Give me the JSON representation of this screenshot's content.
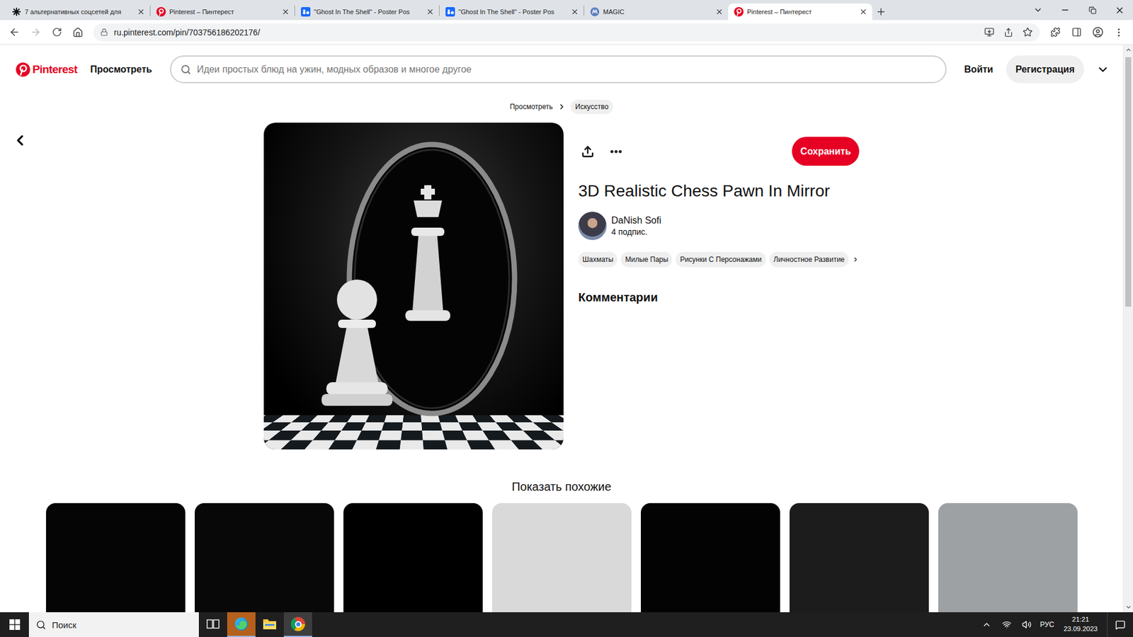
{
  "browser": {
    "tabs": [
      {
        "title": "7 альтернативных соцсетей для",
        "kind": "zen",
        "selected": false
      },
      {
        "title": "Pinterest – Пинтерест",
        "kind": "pinterest",
        "selected": false
      },
      {
        "title": "\"Ghost In The Shell\" - Poster Pos",
        "kind": "behance",
        "selected": false
      },
      {
        "title": "\"Ghost In The Shell\" - Poster Pos",
        "kind": "behance",
        "selected": false
      },
      {
        "title": "MAGIC",
        "kind": "magic",
        "selected": false
      },
      {
        "title": "Pinterest – Пинтерест",
        "kind": "pinterest",
        "selected": true
      }
    ],
    "nav": {
      "back_enabled": true,
      "forward_enabled": false
    },
    "address": "ru.pinterest.com/pin/703756186202176/"
  },
  "header": {
    "logo": "Pinterest",
    "explore": "Просмотреть",
    "search_placeholder": "Идеи простых блюд на ужин, модных образов и многое другое",
    "login": "Войти",
    "signup": "Регистрация"
  },
  "breadcrumbs": [
    {
      "label": "Просмотреть",
      "kind": "link"
    },
    {
      "label": "Искусство",
      "kind": "chip"
    }
  ],
  "pin": {
    "title": "3D Realistic Chess Pawn In Mirror",
    "save": "Сохранить",
    "author": {
      "name": "DaNish Sofi",
      "followers": "4 подпис."
    },
    "tags": [
      "Шахматы",
      "Милые Пары",
      "Рисунки С Персонажами",
      "Личностное Развитие"
    ],
    "comments_heading": "Комментарии"
  },
  "similar": {
    "heading": "Показать похожие",
    "items": [
      {
        "color": "#050505"
      },
      {
        "color": "#080808"
      },
      {
        "color": "#000000"
      },
      {
        "color": "#d9d9d9"
      },
      {
        "color": "#030303"
      },
      {
        "color": "#1c1c1c"
      },
      {
        "color": "#9ea1a4"
      }
    ]
  },
  "scrollbar": {
    "level": 0.46
  },
  "taskbar": {
    "search_placeholder": "Поиск",
    "apps": [
      {
        "kind": "task-view",
        "selected": false,
        "flashing": false
      },
      {
        "kind": "edge",
        "selected": false,
        "flashing": true
      },
      {
        "kind": "explorer",
        "selected": false,
        "flashing": false
      },
      {
        "kind": "chrome",
        "selected": true,
        "flashing": false
      }
    ],
    "language": "РУС",
    "time": "21:21",
    "date": "23.09.2023"
  }
}
